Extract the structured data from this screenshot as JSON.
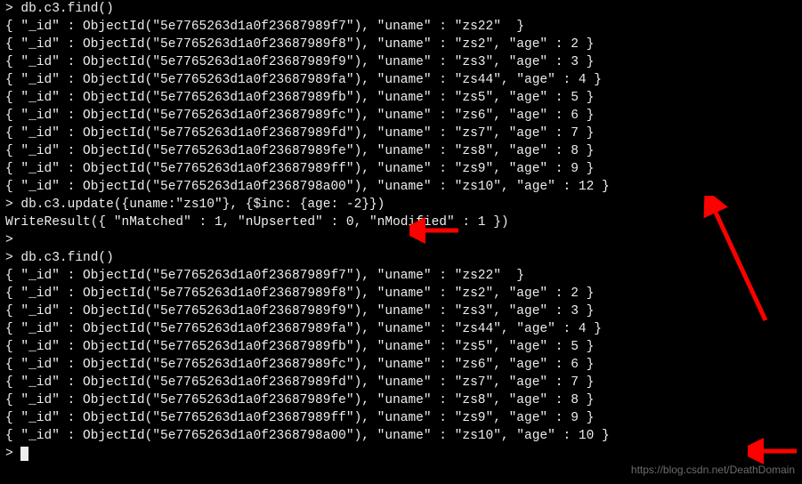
{
  "prompt": ">",
  "commands": {
    "find1": "db.c3.find()",
    "update": "db.c3.update({uname:\"zs10\"}, {$inc: {age: -2}})",
    "update_result": "WriteResult({ \"nMatched\" : 1, \"nUpserted\" : 0, \"nModified\" : 1 })",
    "find2": "db.c3.find()"
  },
  "rows_before": [
    {
      "id": "5e7765263d1a0f23687989f7",
      "uname": "zs22",
      "age": null
    },
    {
      "id": "5e7765263d1a0f23687989f8",
      "uname": "zs2",
      "age": 2
    },
    {
      "id": "5e7765263d1a0f23687989f9",
      "uname": "zs3",
      "age": 3
    },
    {
      "id": "5e7765263d1a0f23687989fa",
      "uname": "zs44",
      "age": 4
    },
    {
      "id": "5e7765263d1a0f23687989fb",
      "uname": "zs5",
      "age": 5
    },
    {
      "id": "5e7765263d1a0f23687989fc",
      "uname": "zs6",
      "age": 6
    },
    {
      "id": "5e7765263d1a0f23687989fd",
      "uname": "zs7",
      "age": 7
    },
    {
      "id": "5e7765263d1a0f23687989fe",
      "uname": "zs8",
      "age": 8
    },
    {
      "id": "5e7765263d1a0f23687989ff",
      "uname": "zs9",
      "age": 9
    },
    {
      "id": "5e7765263d1a0f2368798a00",
      "uname": "zs10",
      "age": 12
    }
  ],
  "rows_after": [
    {
      "id": "5e7765263d1a0f23687989f7",
      "uname": "zs22",
      "age": null
    },
    {
      "id": "5e7765263d1a0f23687989f8",
      "uname": "zs2",
      "age": 2
    },
    {
      "id": "5e7765263d1a0f23687989f9",
      "uname": "zs3",
      "age": 3
    },
    {
      "id": "5e7765263d1a0f23687989fa",
      "uname": "zs44",
      "age": 4
    },
    {
      "id": "5e7765263d1a0f23687989fb",
      "uname": "zs5",
      "age": 5
    },
    {
      "id": "5e7765263d1a0f23687989fc",
      "uname": "zs6",
      "age": 6
    },
    {
      "id": "5e7765263d1a0f23687989fd",
      "uname": "zs7",
      "age": 7
    },
    {
      "id": "5e7765263d1a0f23687989fe",
      "uname": "zs8",
      "age": 8
    },
    {
      "id": "5e7765263d1a0f23687989ff",
      "uname": "zs9",
      "age": 9
    },
    {
      "id": "5e7765263d1a0f2368798a00",
      "uname": "zs10",
      "age": 10
    }
  ],
  "watermark": "https://blog.csdn.net/DeathDomain"
}
